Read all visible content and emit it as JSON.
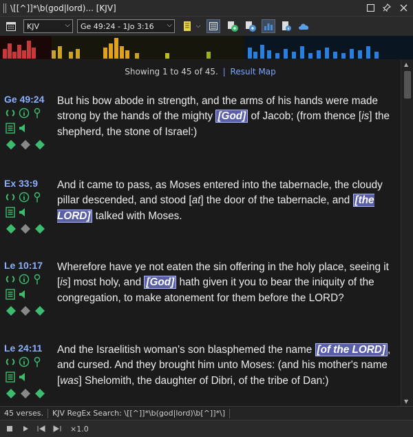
{
  "window": {
    "title": "\\[[^]]*\\b(god|lord)... [KJV]"
  },
  "toolbar": {
    "version_select": "KJV",
    "range_select": "Ge 49:24 - 1Jo 3:16"
  },
  "summary": {
    "showing": "Showing 1 to 45 of 45.",
    "separator": "|",
    "result_map_link": "Result Map"
  },
  "verses": [
    {
      "ref": "Ge 49:24",
      "segments": [
        {
          "t": "But his bow abode in strength, and the arms of his hands were made strong by the hands of the mighty "
        },
        {
          "t": "[God]",
          "hl": true
        },
        {
          "t": " of Jacob; (from thence ["
        },
        {
          "t": "is",
          "it": true
        },
        {
          "t": "] the shepherd, the stone of Israel:)"
        }
      ]
    },
    {
      "ref": "Ex 33:9",
      "segments": [
        {
          "t": "And it came to pass, as Moses entered into the tabernacle, the cloudy pillar descended, and stood ["
        },
        {
          "t": "at",
          "it": true
        },
        {
          "t": "] the door of the tabernacle, and "
        },
        {
          "t": "[the LORD]",
          "hl": true
        },
        {
          "t": " talked with Moses."
        }
      ]
    },
    {
      "ref": "Le 10:17",
      "segments": [
        {
          "t": "Wherefore have ye not eaten the sin offering in the holy place, seeing it ["
        },
        {
          "t": "is",
          "it": true
        },
        {
          "t": "] most holy, and "
        },
        {
          "t": "[God]",
          "hl": true
        },
        {
          "t": " hath given it you to bear the iniquity of the congregation, to make atonement for them before the LORD?"
        }
      ]
    },
    {
      "ref": "Le 24:11",
      "segments": [
        {
          "t": "And the Israelitish woman's son blasphemed the name "
        },
        {
          "t": "[of the LORD]",
          "hl": true
        },
        {
          "t": ", and cursed. And they brought him unto Moses: (and his mother's name ["
        },
        {
          "t": "was",
          "it": true
        },
        {
          "t": "] Shelomith, the daughter of Dibri, of the tribe of Dan:)"
        }
      ]
    }
  ],
  "status": {
    "count": "45 verses.",
    "search": "KJV RegEx Search: \\[[^]]*\\b(god|lord)\\b[^]]*\\]"
  },
  "playback": {
    "speed": "×1.0"
  },
  "colors": {
    "highlight_bg": "#5b5fa8",
    "reference": "#8bb0ff",
    "icon_green": "#3dbb6e"
  }
}
